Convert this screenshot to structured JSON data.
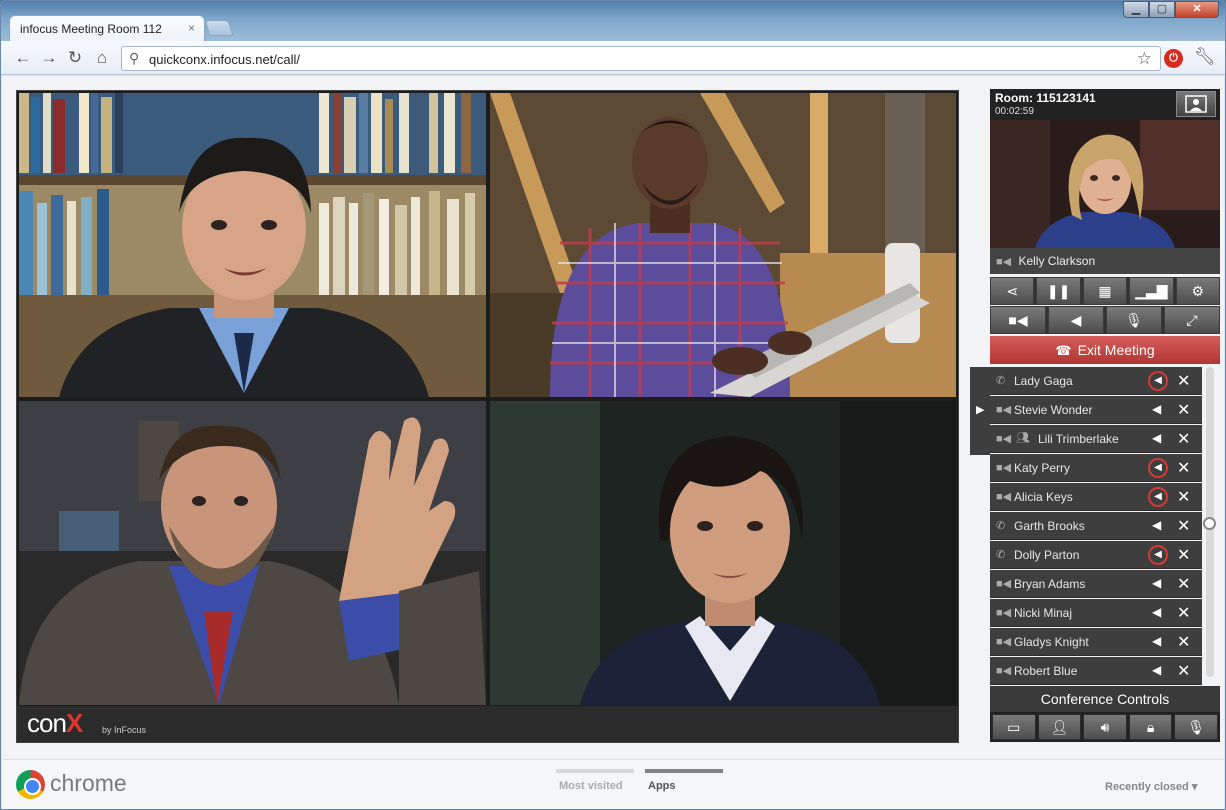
{
  "browser": {
    "tab_title": "infocus Meeting Room 112",
    "tab_close": "×",
    "url": "quickconx.infocus.net/call/",
    "window_controls": [
      "minimize",
      "maximize",
      "close"
    ]
  },
  "call": {
    "brand": "con",
    "brand_x": "X",
    "brand_sub": "by InFocus",
    "room_label": "Room: 115123141",
    "elapsed": "00:02:59",
    "self_name": "Kelly Clarkson",
    "exit_label": "Exit Meeting",
    "controls_row1": [
      "share-icon",
      "pause-icon",
      "grid-icon",
      "stats-icon",
      "settings-icon"
    ],
    "controls_row2": [
      "video-camera-icon",
      "speaker-icon",
      "microphone-icon",
      "fullscreen-icon"
    ],
    "participants": [
      {
        "name": "Lady Gaga",
        "type": "phone",
        "muted": true
      },
      {
        "name": "Stevie Wonder",
        "type": "video",
        "muted": false,
        "selected": true
      },
      {
        "name": "Lili Trimberlake",
        "type": "video-group",
        "muted": false
      },
      {
        "name": "Katy Perry",
        "type": "video",
        "muted": true
      },
      {
        "name": "Alicia Keys",
        "type": "video",
        "muted": true
      },
      {
        "name": "Garth Brooks",
        "type": "phone",
        "muted": false
      },
      {
        "name": "Dolly Parton",
        "type": "phone",
        "muted": true
      },
      {
        "name": "Bryan Adams",
        "type": "video",
        "muted": false
      },
      {
        "name": "Nicki Minaj",
        "type": "video",
        "muted": false
      },
      {
        "name": "Gladys Knight",
        "type": "video",
        "muted": false
      },
      {
        "name": "Robert Blue",
        "type": "video",
        "muted": false
      }
    ],
    "conference_controls_label": "Conference Controls",
    "conference_controls": [
      "layout-icon",
      "presenter-icon",
      "volume-icon",
      "lock-icon",
      "microphone-icon"
    ]
  },
  "new_tab_page": {
    "logo_word": "chrome",
    "tabs": [
      "Most visited",
      "Apps"
    ],
    "active_tab": "Apps",
    "recently_closed": "Recently closed ▾"
  },
  "colors": {
    "exit_red": "#b23633",
    "muted_ring": "#d23b36",
    "brand_red": "#e0352b"
  }
}
